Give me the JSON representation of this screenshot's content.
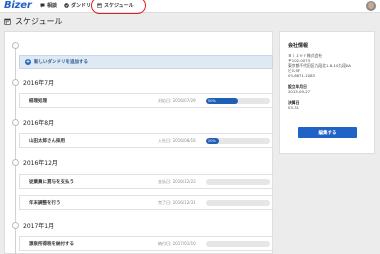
{
  "header": {
    "logo": "Bizer",
    "nav": [
      {
        "label": "相談",
        "icon": "chat-bubble-icon"
      },
      {
        "label": "ダンドリ",
        "icon": "check-circle-icon"
      },
      {
        "label": "スケジュール",
        "icon": "calendar-icon"
      }
    ],
    "avatar_icon": "user-avatar"
  },
  "page": {
    "title": "スケジュール",
    "title_icon": "calendar-icon"
  },
  "timeline": {
    "add_button_label": "新しいダンドリを追加する",
    "groups": [
      {
        "month": "2016年7月",
        "tasks": [
          {
            "name": "経理処理",
            "date": "対応日: 2016/07/29",
            "progress": 50,
            "progress_label": "50%"
          }
        ]
      },
      {
        "month": "2016年8月",
        "tasks": [
          {
            "name": "山田太郎さん採用",
            "date": "入社日: 2016/08/16",
            "progress": 20,
            "progress_label": "20%"
          }
        ]
      },
      {
        "month": "2016年12月",
        "tasks": [
          {
            "name": "従業員に賞与を支払う",
            "date": "支払日: 2016/12/23",
            "progress": 0,
            "progress_label": ""
          },
          {
            "name": "年末調整を行う",
            "date": "完了日: 2016/12/31",
            "progress": 0,
            "progress_label": ""
          }
        ]
      },
      {
        "month": "2017年1月",
        "tasks": [
          {
            "name": "源泉所得税を納付する",
            "date": "納付日: 2017/01/10",
            "progress": 0,
            "progress_label": ""
          }
        ]
      }
    ]
  },
  "company": {
    "heading": "会社情報",
    "name": "Ｂｉｚｅｒ株式会社",
    "postal": "〒102-0073",
    "address1": "東京都千代田区九段北1-8-10九段KA",
    "address2": "ビル5F",
    "phone": "03-6671-1083",
    "founded_label": "設立年月日",
    "founded_value": "2013-09-27",
    "fiscal_label": "決算日",
    "fiscal_value": "03-31",
    "edit_button_label": "編集する"
  },
  "colors": {
    "brand": "#1f63c6",
    "progress": "#1f5fb4",
    "highlight": "#e02020"
  }
}
